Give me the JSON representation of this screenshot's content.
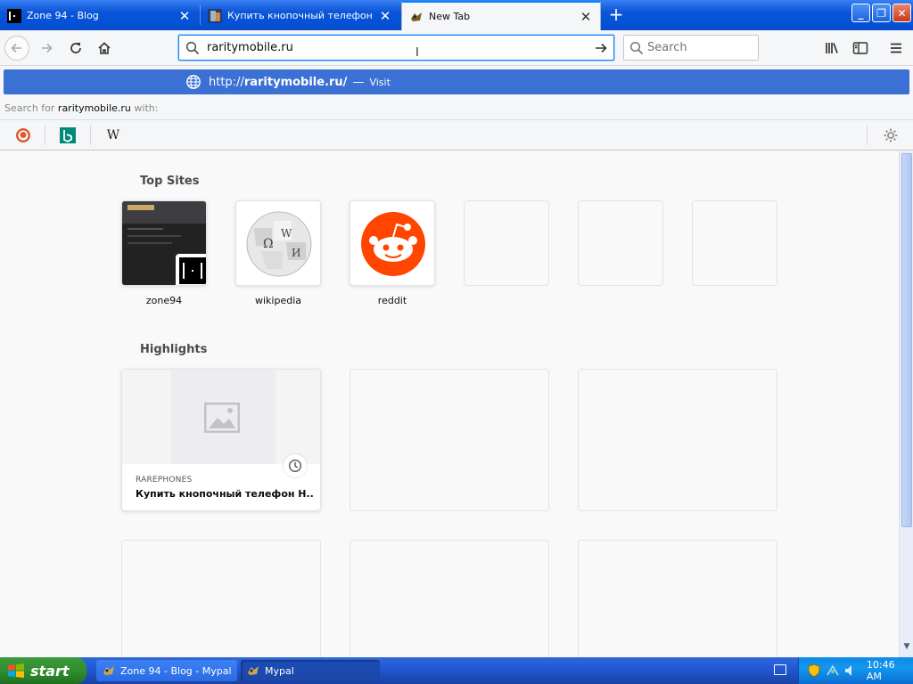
{
  "tabs": [
    {
      "title": "Zone 94 - Blog",
      "active": false
    },
    {
      "title": "Купить кнопочный телефон Hor",
      "active": false
    },
    {
      "title": "New Tab",
      "active": true
    }
  ],
  "urlbar": {
    "value": "raritymobile.ru"
  },
  "searchbar": {
    "placeholder": "Search"
  },
  "autocomplete": {
    "url_prefix": "http://",
    "url_bold": "raritymobile.ru/",
    "dash": "—",
    "action": "Visit",
    "search_for_prefix": "Search for ",
    "search_for_term": "raritymobile.ru",
    "search_for_suffix": " with:",
    "engines": [
      "duckduckgo-icon",
      "bing-icon",
      "wikipedia-icon"
    ]
  },
  "top_sites": {
    "title": "Top Sites",
    "sites": [
      {
        "label": "zone94"
      },
      {
        "label": "wikipedia"
      },
      {
        "label": "reddit"
      }
    ]
  },
  "highlights": {
    "title": "Highlights",
    "card": {
      "source": "RAREPHONES",
      "title": "Купить кнопочный телефон Н..."
    }
  },
  "taskbar": {
    "start_label": "start",
    "items": [
      "Zone 94 - Blog - Mypal",
      "Mypal"
    ],
    "clock": "10:46 AM"
  },
  "colors": {
    "accent": "#0a84ff",
    "popup_highlight": "#3b70d4",
    "reddit": "#ff4500"
  }
}
